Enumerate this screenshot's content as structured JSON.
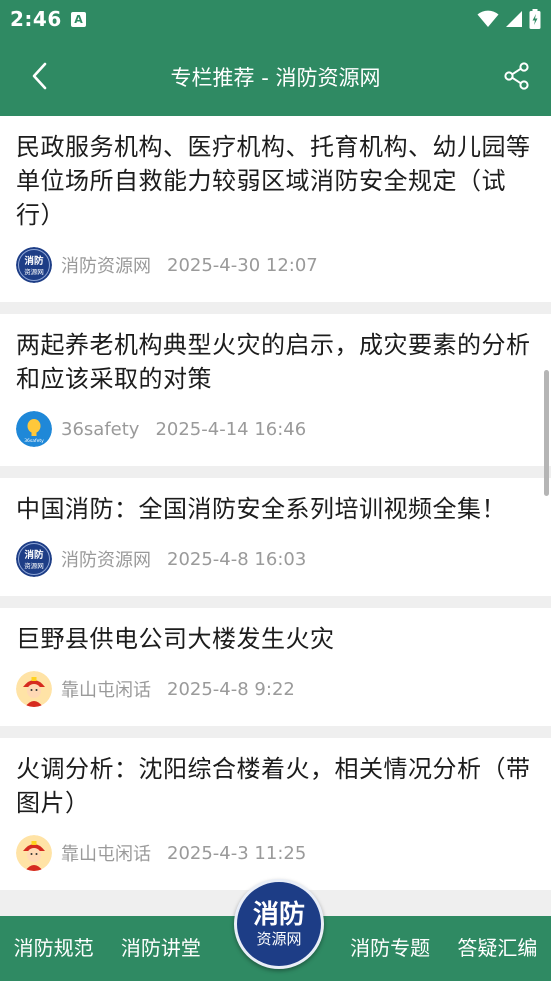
{
  "status_bar": {
    "time": "2:46",
    "notification_letter": "A"
  },
  "header": {
    "title": "专栏推荐 - 消防资源网"
  },
  "articles": [
    {
      "title": "民政服务机构、医疗机构、托育机构、幼儿园等单位场所自救能力较弱区域消防安全规定（试行）",
      "source": "消防资源网",
      "date": "2025-4-30 12:07",
      "avatar_icon": "xiaofang-logo-icon",
      "avatar_text": "消防\n资源网"
    },
    {
      "title": "两起养老机构典型火灾的启示，成灾要素的分析和应该采取的对策",
      "source": "36safety",
      "date": "2025-4-14 16:46",
      "avatar_icon": "36safety-logo-icon",
      "avatar_text": "36safety"
    },
    {
      "title": "中国消防：全国消防安全系列培训视频全集！",
      "source": "消防资源网",
      "date": "2025-4-8 16:03",
      "avatar_icon": "xiaofang-logo-icon",
      "avatar_text": "消防\n资源网"
    },
    {
      "title": "巨野县供电公司大楼发生火灾",
      "source": "靠山屯闲话",
      "date": "2025-4-8 9:22",
      "avatar_icon": "firefighter-avatar-icon"
    },
    {
      "title": "火调分析：沈阳综合楼着火，相关情况分析（带图片）",
      "source": "靠山屯闲话",
      "date": "2025-4-3 11:25",
      "avatar_icon": "firefighter-avatar-icon"
    }
  ],
  "bottom_nav": {
    "items": [
      "消防规范",
      "消防讲堂",
      "消防专题",
      "答疑汇编"
    ],
    "center_logo": {
      "line1": "消防",
      "line2": "资源网"
    }
  },
  "colors": {
    "primary": "#2f8a63",
    "logo_blue": "#1d3d86",
    "meta_text": "#9a9a9a",
    "title_text": "#1c1c1c"
  }
}
